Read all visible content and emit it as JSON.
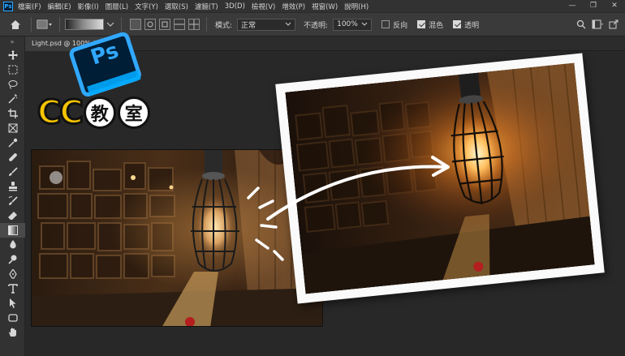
{
  "app": {
    "logo_text": "Ps",
    "menu": [
      "檔案(F)",
      "編輯(E)",
      "影像(I)",
      "圖層(L)",
      "文字(Y)",
      "選取(S)",
      "濾鏡(T)",
      "3D(D)",
      "檢視(V)",
      "增效(P)",
      "視窗(W)",
      "說明(H)"
    ],
    "window_controls": [
      "—",
      "❐",
      "✕"
    ]
  },
  "options_bar": {
    "mode_label": "模式:",
    "mode_value": "正常",
    "opacity_label": "不透明:",
    "opacity_value": "100%",
    "reverse_label": "反向",
    "reverse_checked": false,
    "dither_label": "混色",
    "dither_checked": true,
    "transparency_label": "透明",
    "transparency_checked": true
  },
  "document": {
    "tab_title": "Light.psd @ 100% (RGB/8)"
  },
  "overlay": {
    "badge_text": "Ps",
    "cc_text": "CC",
    "kanji_1": "教",
    "kanji_2": "室"
  },
  "tools": [
    "move-tool",
    "marquee-tool",
    "lasso-tool",
    "magic-wand-tool",
    "crop-tool",
    "frame-tool",
    "eyedropper-tool",
    "healing-brush-tool",
    "brush-tool",
    "clone-stamp-tool",
    "history-brush-tool",
    "eraser-tool",
    "gradient-tool",
    "blur-tool",
    "dodge-tool",
    "pen-tool",
    "type-tool",
    "path-selection-tool",
    "shape-tool",
    "hand-tool"
  ],
  "colors": {
    "ps_blue": "#31a8ff",
    "ps_dark": "#001e36",
    "cc_yellow": "#f5c400"
  }
}
